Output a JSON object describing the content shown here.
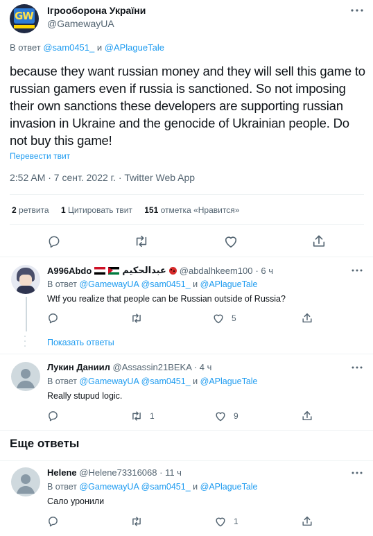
{
  "main_tweet": {
    "author_name": "Ігрооборона України",
    "author_handle": "@GamewayUA",
    "avatar_text": "GW",
    "reply_prefix": "В ответ",
    "reply_to_1": "@sam0451_",
    "reply_and": "и",
    "reply_to_2": "@APlagueTale",
    "text": "because they want russian money and they will sell this game to russian gamers even if russia is sanctioned. So not imposing their own sanctions these developers are supporting russian invasion in Ukraine and the genocide of Ukrainian people. Do not buy this game!",
    "translate": "Перевести твит",
    "timestamp": "2:52 AM · 7 сент. 2022 г. · Twitter Web App",
    "retweets_count": "2",
    "retweets_label": "ретвита",
    "quotes_count": "1",
    "quotes_label": "Цитировать твит",
    "likes_count": "151",
    "likes_label": "отметка «Нравится»"
  },
  "replies": [
    {
      "name": "A996Abdo",
      "name_suffix": "عبدالحكيم",
      "handle": "@abdalhkeem100",
      "time": "· 6 ч",
      "reply_prefix": "В ответ",
      "reply_to_1": "@GamewayUA",
      "reply_to_2": "@sam0451_",
      "reply_and": "и",
      "reply_to_3": "@APlagueTale",
      "text": "Wtf you realize that people can be Russian outside of Russia?",
      "reply_count": "",
      "retweet_count": "",
      "like_count": "5",
      "show_replies": "Показать ответы"
    },
    {
      "name": "Лукин Даниил",
      "handle": "@Assassin21BEKA",
      "time": "· 4 ч",
      "reply_prefix": "В ответ",
      "reply_to_1": "@GamewayUA",
      "reply_to_2": "@sam0451_",
      "reply_and": "и",
      "reply_to_3": "@APlagueTale",
      "text": "Really stupud logic.",
      "reply_count": "",
      "retweet_count": "1",
      "like_count": "9"
    },
    {
      "name": "Helene",
      "handle": "@Helene73316068",
      "time": "· 11 ч",
      "reply_prefix": "В ответ",
      "reply_to_1": "@GamewayUA",
      "reply_to_2": "@sam0451_",
      "reply_and": "и",
      "reply_to_3": "@APlagueTale",
      "text": "Сало уронили",
      "reply_count": "",
      "retweet_count": "",
      "like_count": "1"
    }
  ],
  "more_replies_heading": "Еще ответы",
  "colors": {
    "accent": "#1d9bf0",
    "text": "#0f1419",
    "muted": "#536471",
    "divider": "#eff3f4"
  }
}
